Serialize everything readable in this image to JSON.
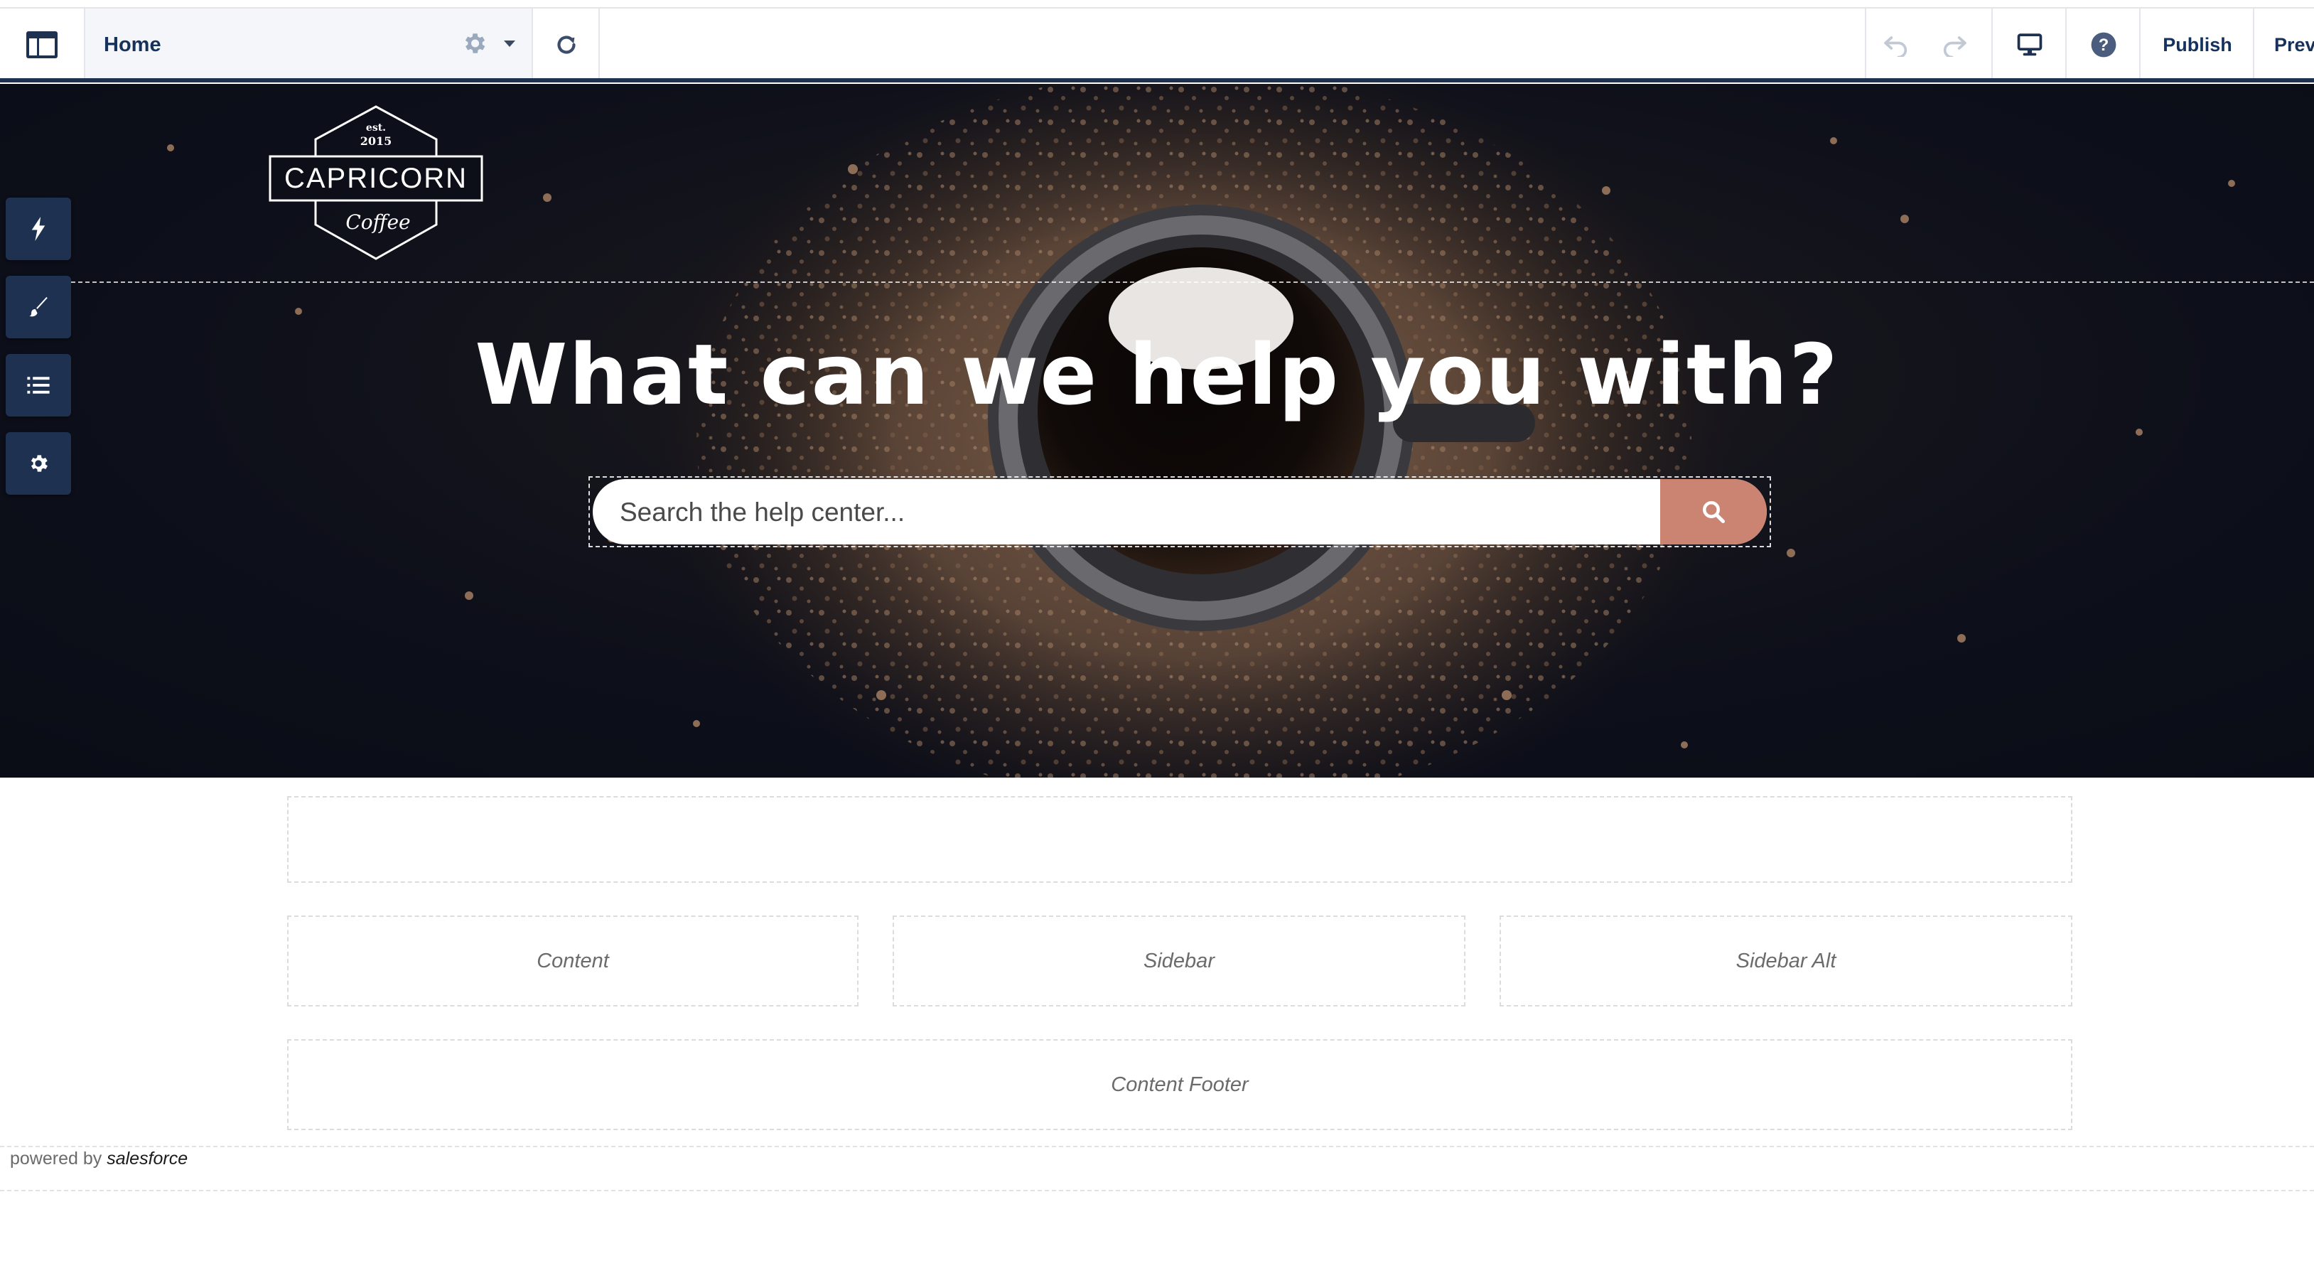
{
  "toolbar": {
    "page_name": "Home",
    "publish_label": "Publish",
    "preview_label": "Prev"
  },
  "hero": {
    "logo": {
      "est": "est.",
      "year": "2015",
      "name": "CAPRICORN",
      "tagline": "Coffee"
    },
    "headline": "What can we help you with?",
    "search": {
      "placeholder": "Search the help center..."
    }
  },
  "regions": {
    "content": "Content",
    "sidebar": "Sidebar",
    "sidebar_alt": "Sidebar Alt",
    "content_footer": "Content Footer"
  },
  "footer": {
    "powered_by": "powered by",
    "brand": "salesforce"
  },
  "colors": {
    "toolbar_accent": "#1f3151",
    "search_button": "#cc8472",
    "rail_button": "#1f3151"
  },
  "icons": {
    "menu": "layout-icon",
    "theme": "gear-icon",
    "refresh": "refresh-icon",
    "undo": "undo-icon",
    "redo": "redo-icon",
    "device": "desktop-icon",
    "help": "help-icon",
    "rail": [
      "lightning-icon",
      "brush-icon",
      "list-icon",
      "settings-icon"
    ],
    "search": "search-icon"
  }
}
